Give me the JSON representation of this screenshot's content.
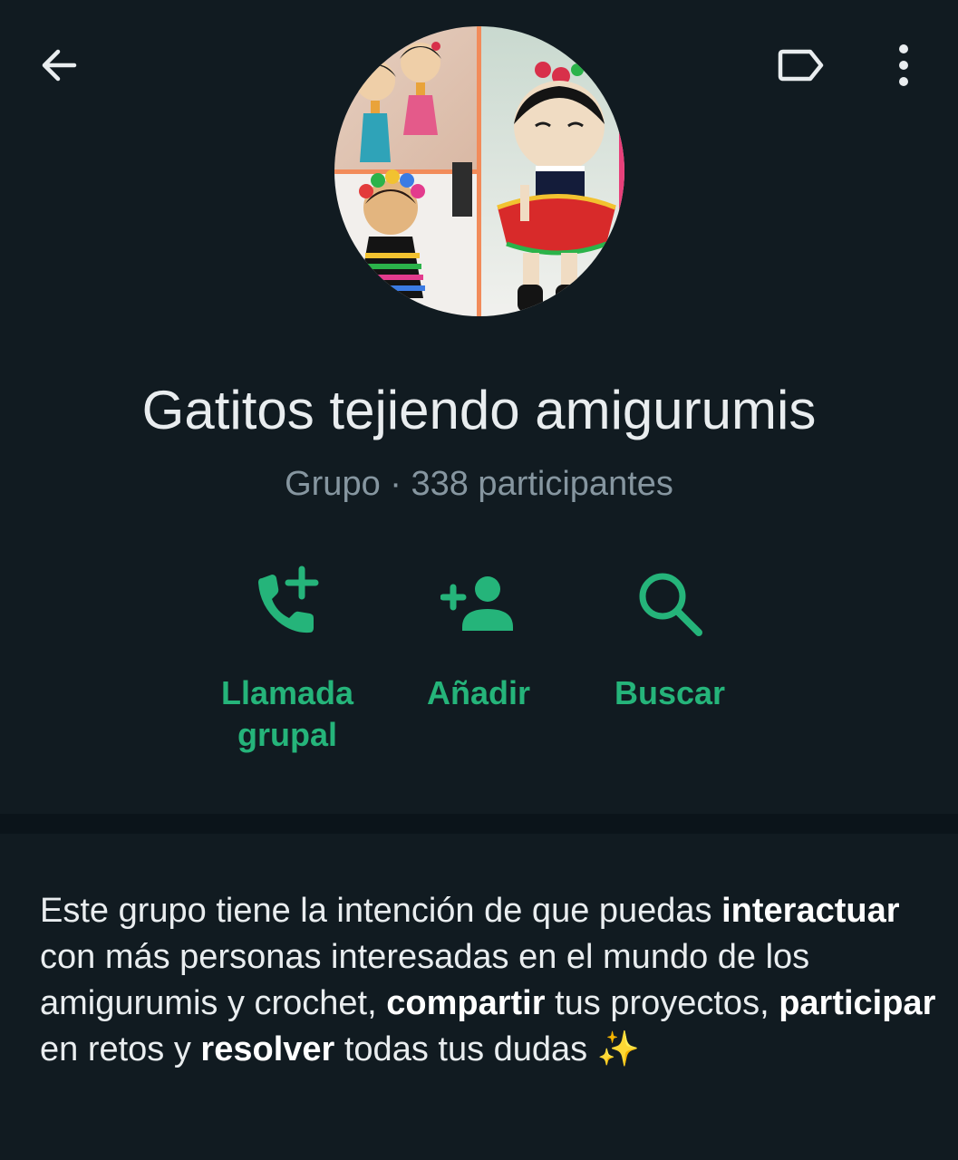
{
  "header": {
    "back_icon": "arrow-left-icon",
    "label_icon": "label-tag-icon",
    "menu_icon": "more-vertical-icon"
  },
  "group": {
    "name": "Gatitos tejiendo amigurumis",
    "meta": "Grupo · 338 participantes"
  },
  "actions": [
    {
      "label": "Llamada grupal",
      "icon": "group-call-add-icon"
    },
    {
      "label": "Añadir",
      "icon": "add-person-icon"
    },
    {
      "label": "Buscar",
      "icon": "search-icon"
    }
  ],
  "description": {
    "segments": [
      {
        "text": "Este grupo tiene la intención de que puedas ",
        "bold": false
      },
      {
        "text": "interactuar",
        "bold": true
      },
      {
        "text": " con más personas interesadas en el mundo de los amigurumis y crochet, ",
        "bold": false
      },
      {
        "text": "compartir",
        "bold": true
      },
      {
        "text": " tus proyectos, ",
        "bold": false
      },
      {
        "text": "participar",
        "bold": true
      },
      {
        "text": " en retos y ",
        "bold": false
      },
      {
        "text": "resolver",
        "bold": true
      },
      {
        "text": " todas tus dudas ",
        "bold": false
      },
      {
        "text": "✨",
        "bold": false
      }
    ]
  },
  "colors": {
    "background": "#111b21",
    "accent": "#25b47a",
    "secondary_text": "#8696a0"
  }
}
